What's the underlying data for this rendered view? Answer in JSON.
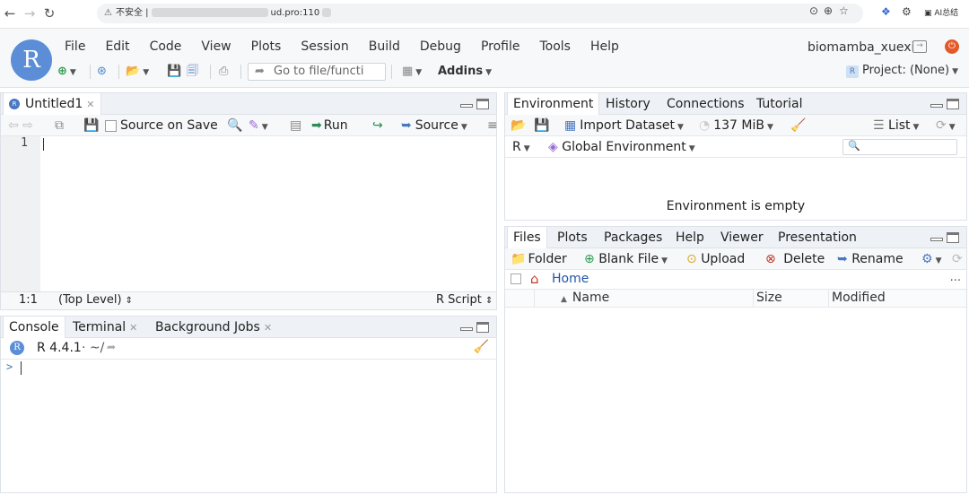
{
  "browser": {
    "security_label": "不安全",
    "url_suffix": "ud.pro:110",
    "ai_label": "AI总结"
  },
  "app": {
    "logo_letter": "R",
    "menu": [
      "File",
      "Edit",
      "Code",
      "View",
      "Plots",
      "Session",
      "Build",
      "Debug",
      "Profile",
      "Tools",
      "Help"
    ],
    "user": "biomamba_xuexi",
    "toolbar": {
      "goto_placeholder": "Go to file/functi",
      "addins_label": "Addins",
      "project_label": "Project: (None)"
    }
  },
  "source_pane": {
    "tab_label": "Untitled1",
    "source_on_save_label": "Source on Save",
    "run_label": "Run",
    "source_label": "Source",
    "line_number": "1",
    "status_position": "1:1",
    "status_scope": "(Top Level)",
    "status_type": "R Script"
  },
  "console_pane": {
    "tabs": [
      "Console",
      "Terminal",
      "Background Jobs"
    ],
    "r_version": "R 4.4.1",
    "working_dir": "· ~/",
    "prompt": ">"
  },
  "env_pane": {
    "tabs": [
      "Environment",
      "History",
      "Connections",
      "Tutorial"
    ],
    "import_label": "Import Dataset",
    "memory_label": "137 MiB",
    "view_label": "List",
    "lang_label": "R",
    "scope_label": "Global Environment",
    "empty_message": "Environment is empty"
  },
  "files_pane": {
    "tabs": [
      "Files",
      "Plots",
      "Packages",
      "Help",
      "Viewer",
      "Presentation"
    ],
    "folder_label": "Folder",
    "blank_file_label": "Blank File",
    "upload_label": "Upload",
    "delete_label": "Delete",
    "rename_label": "Rename",
    "breadcrumb_home": "Home",
    "columns": [
      "Name",
      "Size",
      "Modified"
    ],
    "more_label": "..."
  }
}
